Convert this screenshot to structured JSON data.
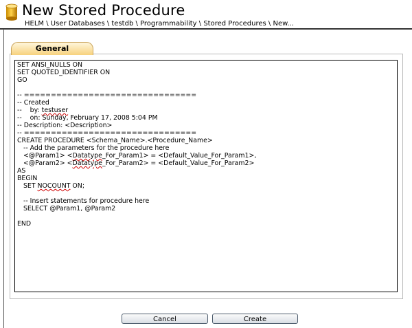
{
  "header": {
    "title": "New Stored Procedure",
    "icon": "database-icon",
    "breadcrumb": "HELM \\ User Databases \\ testdb \\ Programmability \\ Stored Procedures \\ New..."
  },
  "tabs": [
    {
      "label": "General",
      "active": true
    }
  ],
  "editor": {
    "lines": [
      [
        {
          "t": "SET ANSI_NULLS ON"
        }
      ],
      [
        {
          "t": "SET QUOTED_IDENTIFIER ON"
        }
      ],
      [
        {
          "t": "GO"
        }
      ],
      [
        {
          "t": ""
        }
      ],
      [
        {
          "t": "-- ================================"
        }
      ],
      [
        {
          "t": "-- Created"
        }
      ],
      [
        {
          "t": "--    by: "
        },
        {
          "t": "testuser",
          "sq": true
        }
      ],
      [
        {
          "t": "--    on: Sunday, February 17, 2008 5:04 PM"
        }
      ],
      [
        {
          "t": "-- Description: <Description>"
        }
      ],
      [
        {
          "t": "-- ================================"
        }
      ],
      [
        {
          "t": "CREATE PROCEDURE <Schema_Name>.<Procedure_Name>"
        }
      ],
      [
        {
          "t": "   -- Add the parameters for the procedure here"
        }
      ],
      [
        {
          "t": "   <@Param1> <"
        },
        {
          "t": "Datatype",
          "sq": true
        },
        {
          "t": "_For_Param1> = <Default_Value_For_Param1>,"
        }
      ],
      [
        {
          "t": "   <@Param2> <"
        },
        {
          "t": "Datatype",
          "sq": true
        },
        {
          "t": "_For_Param2> = <Default_Value_For_Param2>"
        }
      ],
      [
        {
          "t": "AS"
        }
      ],
      [
        {
          "t": "BEGIN"
        }
      ],
      [
        {
          "t": "   SET "
        },
        {
          "t": "NOCOUNT",
          "sq": true
        },
        {
          "t": " ON;"
        }
      ],
      [
        {
          "t": ""
        }
      ],
      [
        {
          "t": "   -- Insert statements for procedure here"
        }
      ],
      [
        {
          "t": "   SELECT @Param1, @Param2"
        }
      ],
      [
        {
          "t": ""
        }
      ],
      [
        {
          "t": "END"
        }
      ]
    ]
  },
  "buttons": {
    "cancel": "Cancel",
    "create": "Create"
  },
  "colors": {
    "tab_active": "#f7d27e",
    "spellcheck": "#d00000",
    "border": "#000000"
  }
}
